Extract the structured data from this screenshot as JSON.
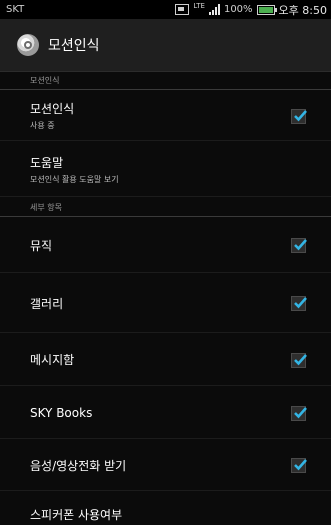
{
  "status_bar": {
    "carrier": "SKT",
    "network_label": "LTE",
    "battery_text": "100%",
    "time": "오후 8:50"
  },
  "action_bar": {
    "title": "모션인식",
    "icon": "motion-sensor-icon"
  },
  "sections": [
    {
      "header": "모션인식"
    },
    {
      "header": "세부 항목"
    }
  ],
  "items": [
    {
      "title": "모션인식",
      "subtitle": "사용 중",
      "checked": true
    },
    {
      "title": "도움말",
      "subtitle": "모션인식 활용 도움말 보기",
      "checked": false
    },
    {
      "title": "뮤직",
      "checked": true
    },
    {
      "title": "갤러리",
      "checked": true
    },
    {
      "title": "메시지함",
      "checked": true
    },
    {
      "title": "SKY Books",
      "checked": true
    },
    {
      "title": "음성/영상전화 받기",
      "checked": true
    },
    {
      "title": "스피커폰 사용여부"
    }
  ],
  "colors": {
    "background": "#0b0b0b",
    "action_bar": "#1f1f1f",
    "check_accent": "#33b5e5"
  }
}
